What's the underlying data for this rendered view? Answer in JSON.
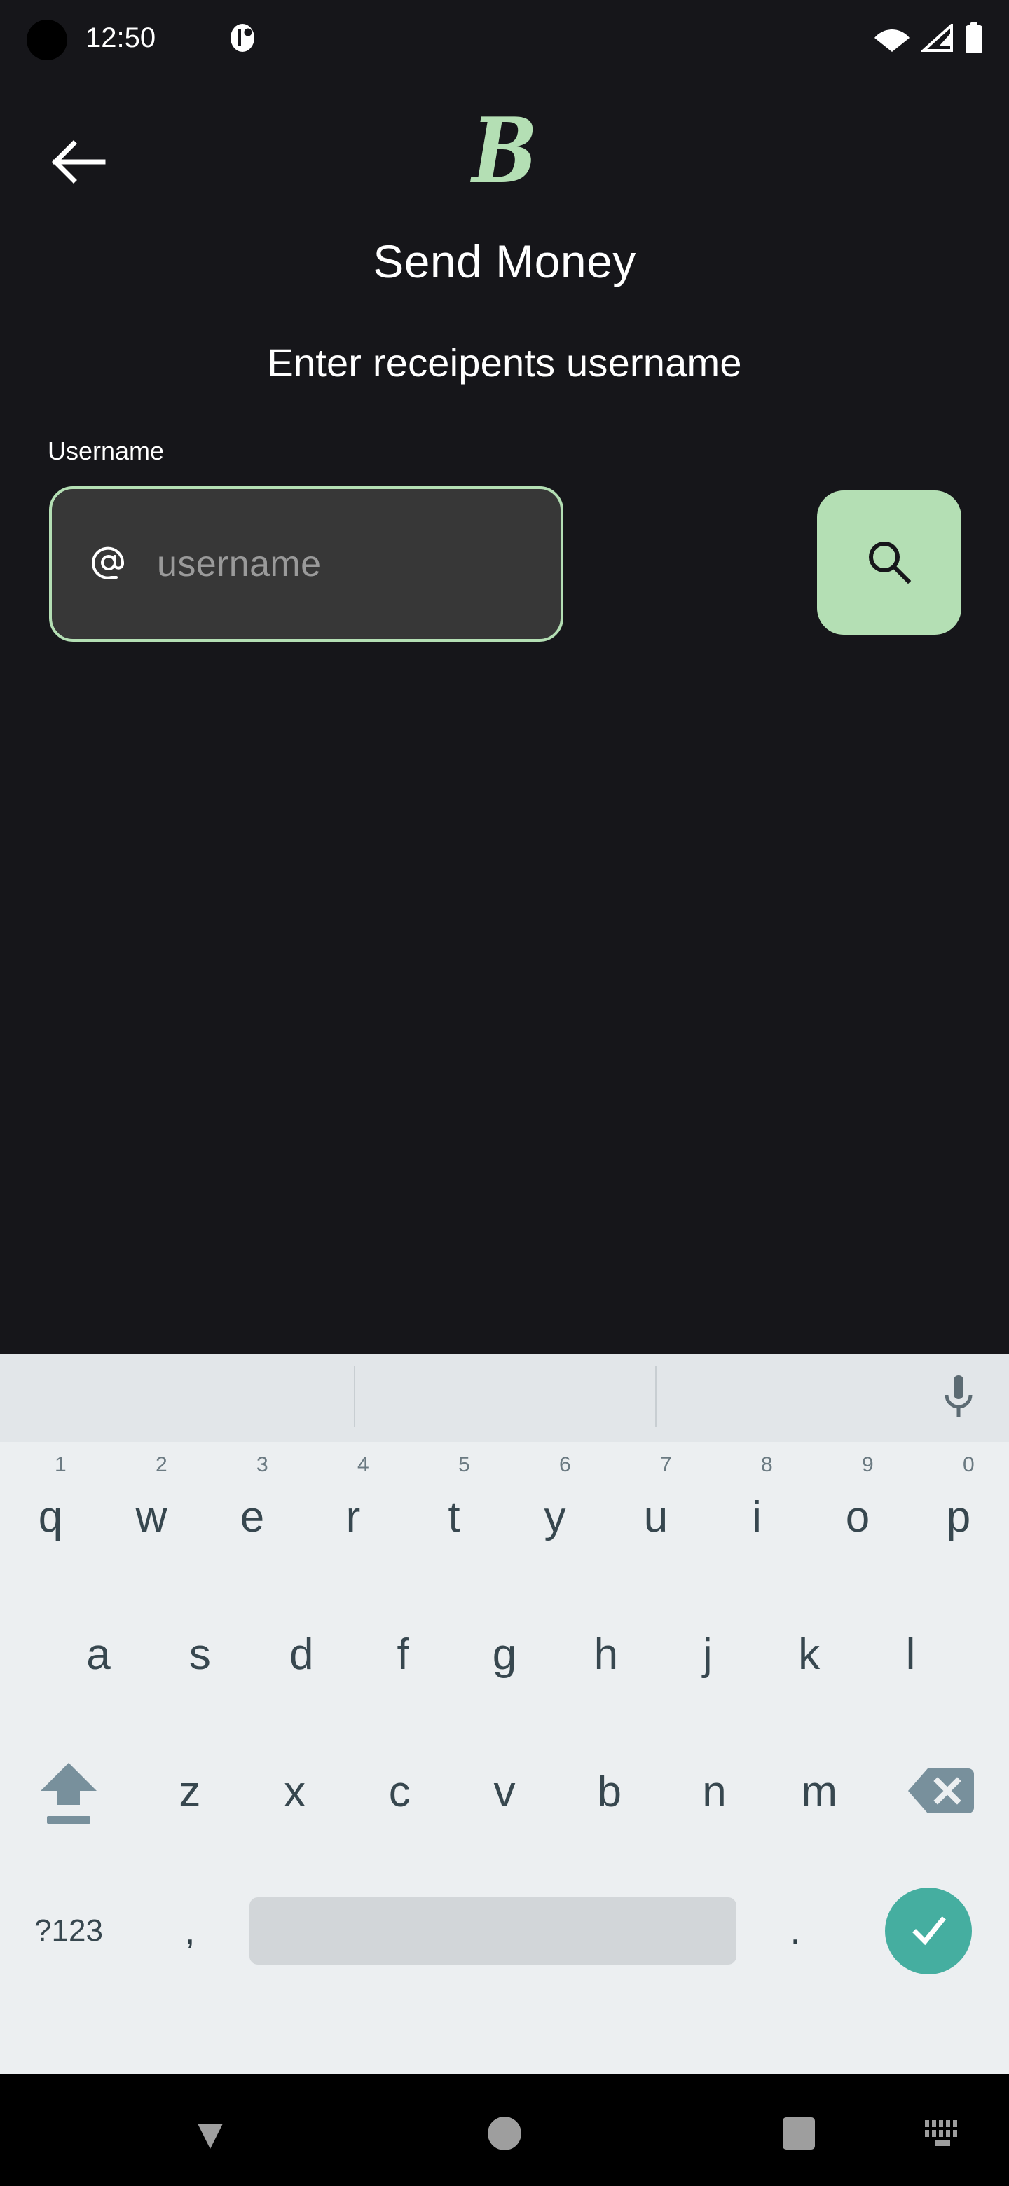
{
  "status_bar": {
    "time": "12:50",
    "icons": {
      "punch_hole": "camera-punch-hole",
      "notification": "notification-icon",
      "wifi": "wifi-icon",
      "cellular": "cellular-signal-icon",
      "battery": "battery-icon"
    }
  },
  "header": {
    "back_icon": "arrow-left-icon",
    "logo_glyph": "B",
    "title": "Send Money",
    "subtitle": "Enter receipents username"
  },
  "form": {
    "field_label": "Username",
    "at_icon": "at-sign-icon",
    "username_value": "",
    "username_placeholder": "username",
    "search_icon": "search-icon"
  },
  "colors": {
    "background": "#16161a",
    "accent_green": "#b4dfb4",
    "input_fill": "#373737",
    "placeholder": "#9a9a9a",
    "keyboard_bg": "#eceff1",
    "suggestion_bg": "#e2e6e9",
    "key_text": "#37474f",
    "enter_teal": "#45aea0",
    "spacebar": "#d2d6d9",
    "nav_bg": "#000000"
  },
  "keyboard": {
    "suggestions": [
      "",
      "",
      ""
    ],
    "mic_icon": "microphone-icon",
    "row1": [
      {
        "letter": "q",
        "hint": "1"
      },
      {
        "letter": "w",
        "hint": "2"
      },
      {
        "letter": "e",
        "hint": "3"
      },
      {
        "letter": "r",
        "hint": "4"
      },
      {
        "letter": "t",
        "hint": "5"
      },
      {
        "letter": "y",
        "hint": "6"
      },
      {
        "letter": "u",
        "hint": "7"
      },
      {
        "letter": "i",
        "hint": "8"
      },
      {
        "letter": "o",
        "hint": "9"
      },
      {
        "letter": "p",
        "hint": "0"
      }
    ],
    "row2": [
      {
        "letter": "a"
      },
      {
        "letter": "s"
      },
      {
        "letter": "d"
      },
      {
        "letter": "f"
      },
      {
        "letter": "g"
      },
      {
        "letter": "h"
      },
      {
        "letter": "j"
      },
      {
        "letter": "k"
      },
      {
        "letter": "l"
      }
    ],
    "row3": [
      {
        "letter": "z"
      },
      {
        "letter": "x"
      },
      {
        "letter": "c"
      },
      {
        "letter": "v"
      },
      {
        "letter": "b"
      },
      {
        "letter": "n"
      },
      {
        "letter": "m"
      }
    ],
    "shift_icon": "shift-icon",
    "backspace_icon": "backspace-icon",
    "symbols_label": "?123",
    "comma_label": ",",
    "period_label": ".",
    "space_label": "",
    "enter_icon": "checkmark-icon"
  },
  "nav_bar": {
    "back_icon": "hide-keyboard-down-arrow-icon",
    "home_icon": "home-circle-icon",
    "recents_icon": "recents-square-icon",
    "keyboard_switch_icon": "keyboard-switcher-icon"
  }
}
